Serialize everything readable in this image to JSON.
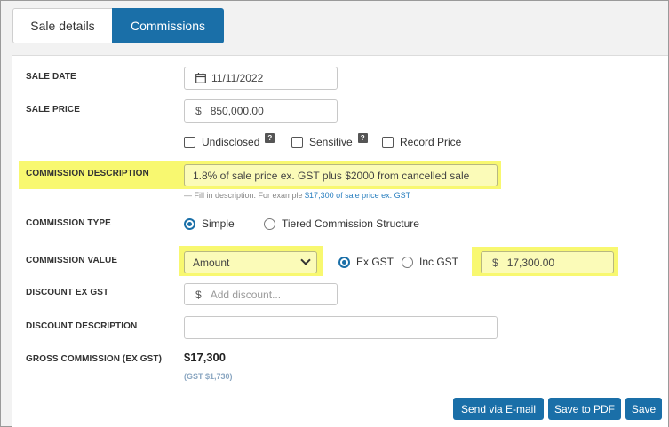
{
  "tabs": [
    {
      "label": "Sale details",
      "active": false
    },
    {
      "label": "Commissions",
      "active": true
    }
  ],
  "sale_date": {
    "label": "SALE DATE",
    "value": "11/11/2022",
    "icon": "calendar-icon"
  },
  "sale_price": {
    "label": "SALE PRICE",
    "prefix": "$",
    "value": "850,000.00"
  },
  "checkboxes": [
    {
      "label": "Undisclosed",
      "checked": false,
      "help": "?"
    },
    {
      "label": "Sensitive",
      "checked": false,
      "help": "?"
    },
    {
      "label": "Record Price",
      "checked": false
    }
  ],
  "commission_description": {
    "label": "COMMISSION DESCRIPTION",
    "value": "1.8% of sale price ex. GST plus $2000 from cancelled sale",
    "hint_prefix": "— Fill in description. For example ",
    "hint_example": "$17,300 of sale price ex. GST"
  },
  "commission_type": {
    "label": "COMMISSION TYPE",
    "options": [
      {
        "label": "Simple",
        "selected": true
      },
      {
        "label": "Tiered Commission Structure",
        "selected": false
      }
    ]
  },
  "commission_value": {
    "label": "COMMISSION VALUE",
    "select_value": "Amount",
    "gst_options": [
      {
        "label": "Ex GST",
        "selected": true
      },
      {
        "label": "Inc GST",
        "selected": false
      }
    ],
    "prefix": "$",
    "amount": "17,300.00"
  },
  "discount_ex_gst": {
    "label": "DISCOUNT EX GST",
    "prefix": "$",
    "placeholder": "Add discount..."
  },
  "discount_description": {
    "label": "DISCOUNT DESCRIPTION",
    "value": ""
  },
  "gross_commission": {
    "label": "GROSS COMMISSION (EX GST)",
    "value": "$17,300",
    "gst": "(GST $1,730)"
  },
  "buttons": {
    "email": "Send via E-mail",
    "pdf": "Save to PDF",
    "save": "Save"
  },
  "colors": {
    "accent": "#1a6fa8",
    "highlight": "#f8f870"
  }
}
